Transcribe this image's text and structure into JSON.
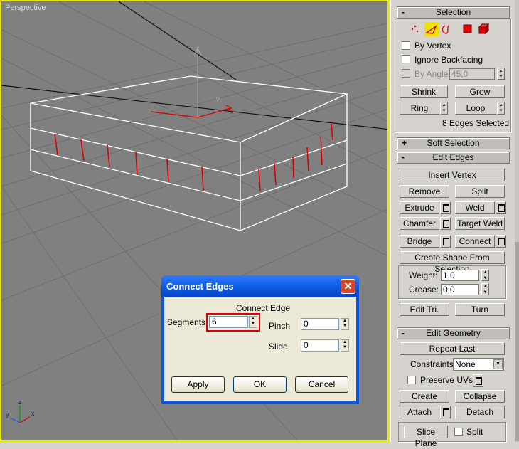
{
  "viewport": {
    "label": "Perspective",
    "axis_z": "z",
    "axis_x": "x",
    "axis_y": "y"
  },
  "selection": {
    "title": "Selection",
    "by_vertex": "By Vertex",
    "ignore_backfacing": "Ignore Backfacing",
    "by_angle": "By Angle:",
    "angle_value": "45,0",
    "shrink": "Shrink",
    "grow": "Grow",
    "ring": "Ring",
    "loop": "Loop",
    "status": "8 Edges Selected"
  },
  "soft_selection": {
    "title": "Soft Selection"
  },
  "edit_edges": {
    "title": "Edit Edges",
    "insert_vertex": "Insert Vertex",
    "remove": "Remove",
    "split": "Split",
    "extrude": "Extrude",
    "weld": "Weld",
    "chamfer": "Chamfer",
    "target_weld": "Target Weld",
    "bridge": "Bridge",
    "connect": "Connect",
    "create_shape": "Create Shape From Selection",
    "weight_label": "Weight:",
    "weight_value": "1,0",
    "crease_label": "Crease:",
    "crease_value": "0,0",
    "edit_tri": "Edit Tri.",
    "turn": "Turn"
  },
  "edit_geometry": {
    "title": "Edit Geometry",
    "repeat_last": "Repeat Last",
    "constraints_label": "Constraints:",
    "constraints_value": "None",
    "preserve_uvs": "Preserve UVs",
    "create": "Create",
    "collapse": "Collapse",
    "attach": "Attach",
    "detach": "Detach",
    "slice_plane": "Slice Plane",
    "split": "Split"
  },
  "dialog": {
    "title": "Connect Edges",
    "group_label": "Connect Edge",
    "segments_label": "Segments:",
    "segments_value": "6",
    "pinch_label": "Pinch",
    "pinch_value": "0",
    "slide_label": "Slide",
    "slide_value": "0",
    "apply": "Apply",
    "ok": "OK",
    "cancel": "Cancel",
    "close_glyph": "✕"
  },
  "colors": {
    "viewport_bg": "#808080",
    "active_border": "#e8e800",
    "selected_edge": "#e00000",
    "panel_bg": "#d6d3ce",
    "xp_blue": "#0a54e6"
  }
}
